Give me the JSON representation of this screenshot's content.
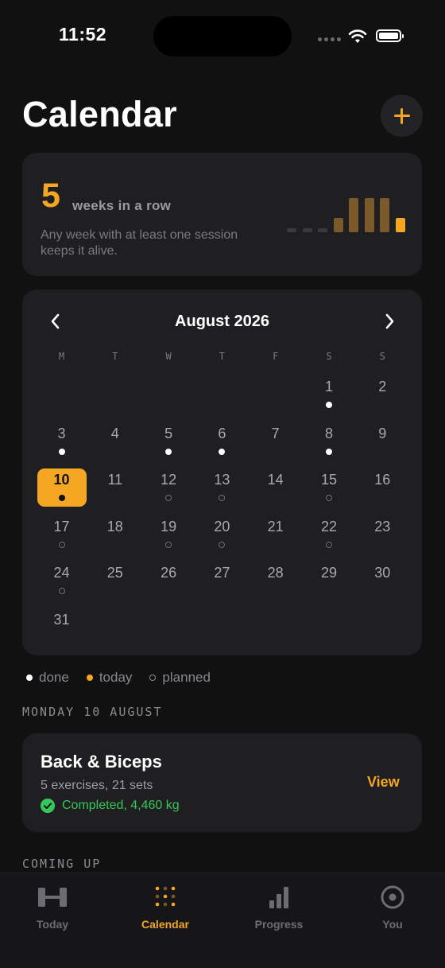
{
  "status_bar": {
    "time": "11:52"
  },
  "header": {
    "title": "Calendar"
  },
  "streak": {
    "count": "5",
    "label": "weeks in a row",
    "description": "Any week with at least one session keeps it alive.",
    "bars": [
      {
        "level": 0,
        "state": "empty"
      },
      {
        "level": 0,
        "state": "empty"
      },
      {
        "level": 0,
        "state": "empty"
      },
      {
        "level": 0.35,
        "state": "past"
      },
      {
        "level": 0.85,
        "state": "past"
      },
      {
        "level": 0.85,
        "state": "past"
      },
      {
        "level": 0.85,
        "state": "past"
      },
      {
        "level": 0.35,
        "state": "current"
      }
    ]
  },
  "calendar": {
    "month_label": "August 2026",
    "weekdays": [
      "M",
      "T",
      "W",
      "T",
      "F",
      "S",
      "S"
    ],
    "first_weekday_index": 5,
    "days_in_month": 31,
    "today": 10,
    "done_days": [
      1,
      3,
      5,
      6,
      8,
      10
    ],
    "planned_days": [
      12,
      13,
      15,
      17,
      19,
      20,
      22,
      24
    ]
  },
  "legend": {
    "done": "done",
    "today": "today",
    "planned": "planned"
  },
  "selected_day": {
    "heading": "MONDAY 10 AUGUST",
    "session": {
      "title": "Back & Biceps",
      "summary": "5 exercises, 21 sets",
      "status": "Completed, 4,460 kg",
      "action": "View"
    }
  },
  "coming_up": {
    "heading": "COMING UP"
  },
  "tabs": [
    {
      "label": "Today",
      "icon": "dumbbell-icon",
      "active": false
    },
    {
      "label": "Calendar",
      "icon": "calendar-dots-icon",
      "active": true
    },
    {
      "label": "Progress",
      "icon": "bar-chart-icon",
      "active": false
    },
    {
      "label": "You",
      "icon": "profile-circle-icon",
      "active": false
    }
  ],
  "colors": {
    "accent": "#f5a623",
    "accent_dim": "#7a5a2a",
    "success": "#34c759",
    "background": "#111112",
    "card": "#1f1f22"
  }
}
